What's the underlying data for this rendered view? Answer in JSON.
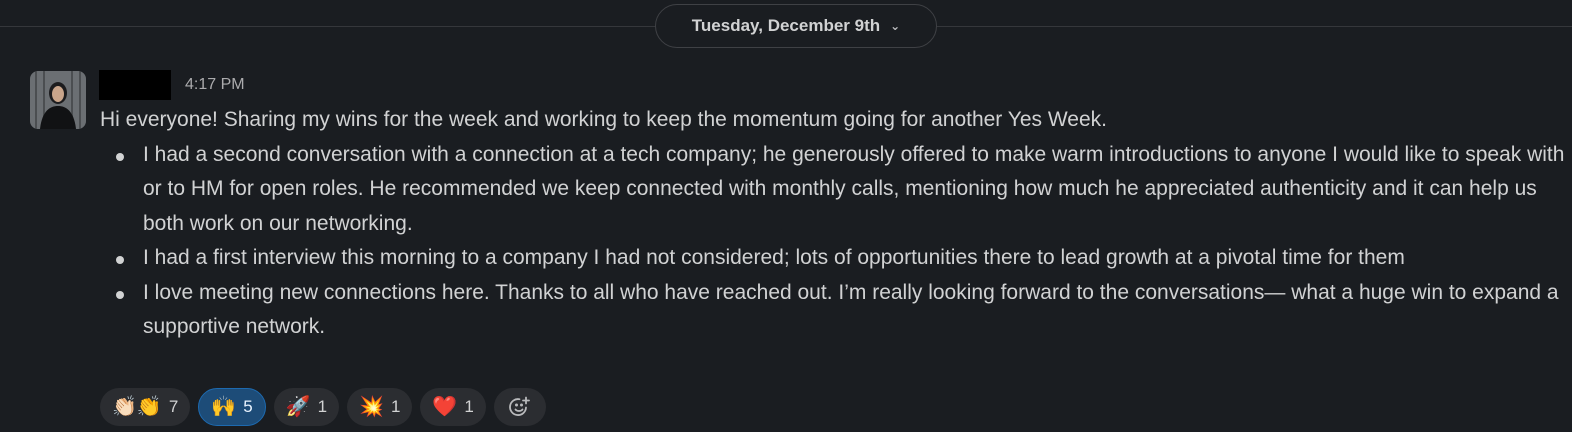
{
  "divider": {
    "date_label": "Tuesday, December 9th"
  },
  "message": {
    "time": "4:17 PM",
    "intro": "Hi everyone! Sharing my wins for the week and working to keep the momentum going for another Yes Week.",
    "bullets": [
      "I had a second conversation with a connection at a tech company; he generously offered to make warm introductions to anyone I would like to speak with or to HM for open roles. He recommended we keep connected with monthly calls, mentioning how much he appreciated authenticity and it can help us both work on our networking.",
      "I had a first interview this morning to a company I had not considered; lots of opportunities there to lead growth at a pivotal time for them",
      "I love meeting new connections here. Thanks to all who have reached out. I’m really looking forward to the conversations— what a huge win to expand a supportive network."
    ]
  },
  "reactions": [
    {
      "icon": "clapping-hands-icon",
      "emoji": "👏🏻👏",
      "count": "7",
      "active": false
    },
    {
      "icon": "raising-hands-icon",
      "emoji": "🙌",
      "count": "5",
      "active": true
    },
    {
      "icon": "rocket-icon",
      "emoji": "🚀",
      "count": "1",
      "active": false
    },
    {
      "icon": "boom-icon",
      "emoji": "💥",
      "count": "1",
      "active": false
    },
    {
      "icon": "red-heart-icon",
      "emoji": "❤️",
      "count": "1",
      "active": false
    }
  ],
  "colors": {
    "background": "#1a1d21",
    "text": "#d1d2d3",
    "muted": "#ababad",
    "active_reaction": "#1d4c78"
  }
}
